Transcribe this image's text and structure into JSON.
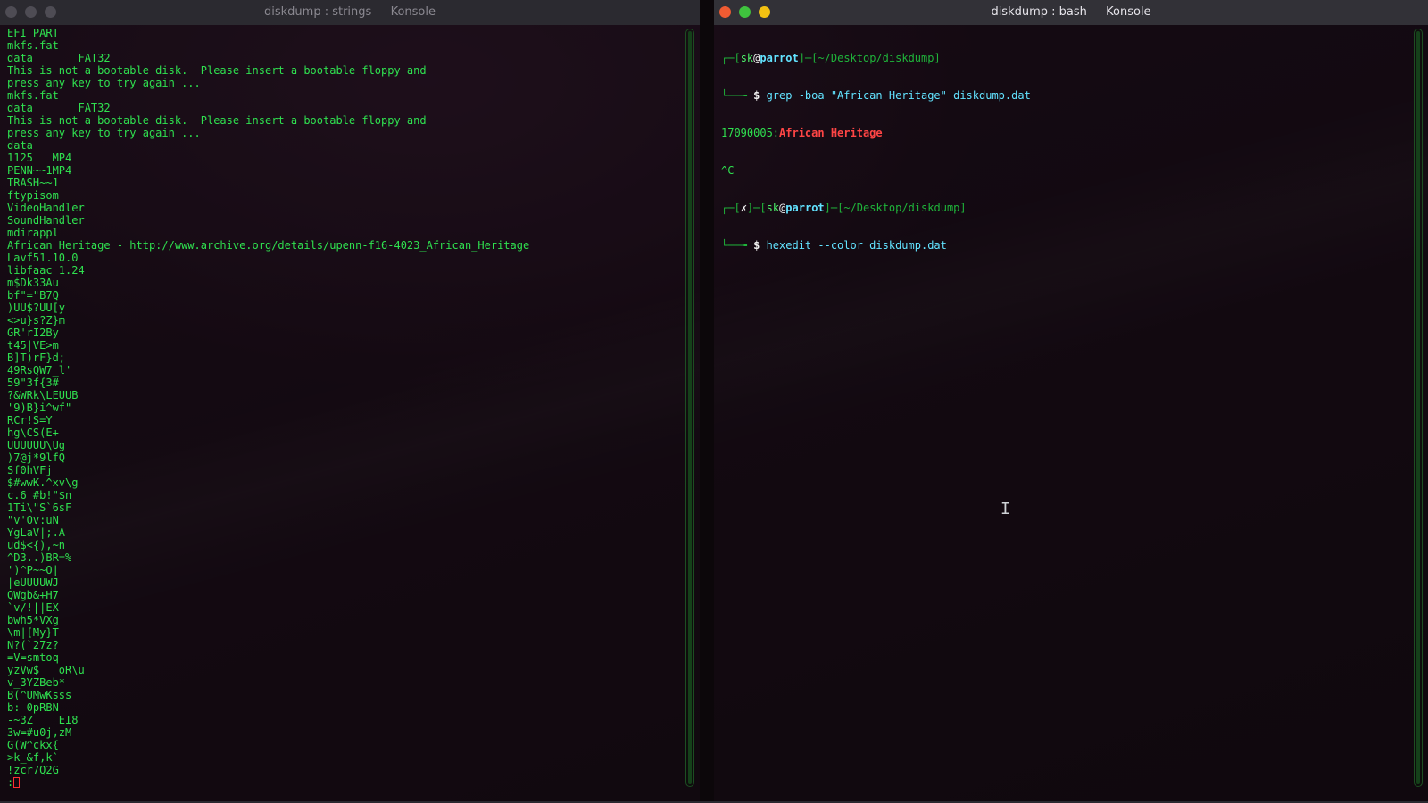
{
  "left_window": {
    "title": "diskdump : strings — Konsole",
    "lines": [
      "EFI PART",
      "mkfs.fat",
      "data       FAT32",
      "This is not a bootable disk.  Please insert a bootable floppy and",
      "press any key to try again ...",
      "mkfs.fat",
      "data       FAT32",
      "This is not a bootable disk.  Please insert a bootable floppy and",
      "press any key to try again ...",
      "data",
      "1125   MP4",
      "PENN~~1MP4",
      "TRASH~~1",
      "ftypisom",
      "VideoHandler",
      "SoundHandler",
      "mdirappl",
      "African Heritage - http://www.archive.org/details/upenn-f16-4023_African_Heritage",
      "Lavf51.10.0",
      "libfaac 1.24",
      "m$Dk33Au",
      "bf\"=\"B7Q",
      ")UU$?UU[y",
      "<>u}s?Z}m",
      "GR'rI2By",
      "t45|VE>m",
      "B]T)rF}d;",
      "49RsQW7_l'",
      "59\"3f{3#",
      "?&WRk\\LEUUB",
      "'9)B}i^wf\"",
      "RCr!S=Y",
      "hg\\CS(E+",
      "UUUUUU\\Ug",
      ")7@j*9lfQ",
      "Sf0hVFj",
      "$#wwK.^xv\\g",
      "c.6 #b!\"$n",
      "1Ti\\\"S`6sF",
      "\"v'Ov:uN",
      "YgLaV|;.A",
      "ud$<{),~n",
      "^D3..)BR=%",
      "')^P~~O|",
      "|eUUUUWJ",
      "QWgb&+H7",
      "`v/!||EX-",
      "bwh5*VXg",
      "\\m|[My}T",
      "N?(`27z?",
      "=V=smtoq",
      "yzVw$   oR\\u",
      "v_3YZBeb*",
      "B(^UMwKsss",
      "b: 0pRBN",
      "-~3Z    EI8",
      "3w=#u0j,zM",
      "G(W^ckx{",
      ">k_&f,k`",
      "!zcr7Q2G"
    ],
    "prompt_char": ":"
  },
  "right_window": {
    "title": "diskdump : bash — Konsole",
    "prompt1": {
      "frame_open": "┌─[",
      "user": "sk",
      "at": "@",
      "host": "parrot",
      "mid": "]─[",
      "path": "~/Desktop/diskdump",
      "frame_close": "]",
      "corner": "└──╼ ",
      "dollar": "$",
      "command": " grep -boa \"African Heritage\" diskdump.dat"
    },
    "output_offset": "17090005",
    "output_sep": ":",
    "output_match": "African Heritage",
    "interrupt": "^C",
    "prompt2": {
      "frame_open": "┌─[",
      "status": "✗",
      "mid0": "]─[",
      "user": "sk",
      "at": "@",
      "host": "parrot",
      "mid": "]─[",
      "path": "~/Desktop/diskdump",
      "frame_close": "]",
      "corner": "└──╼ ",
      "dollar": "$",
      "command": " hexedit --color diskdump.dat"
    }
  },
  "colors": {
    "terminal_green": "#2fe04f",
    "host_cyan": "#62e3ff",
    "match_red": "#ff4545",
    "close_button": "#ef5b32",
    "minimize_button": "#3fc23e",
    "maximize_button": "#f3c112"
  },
  "icons": {
    "mouse_cursor": "i-beam-icon"
  }
}
